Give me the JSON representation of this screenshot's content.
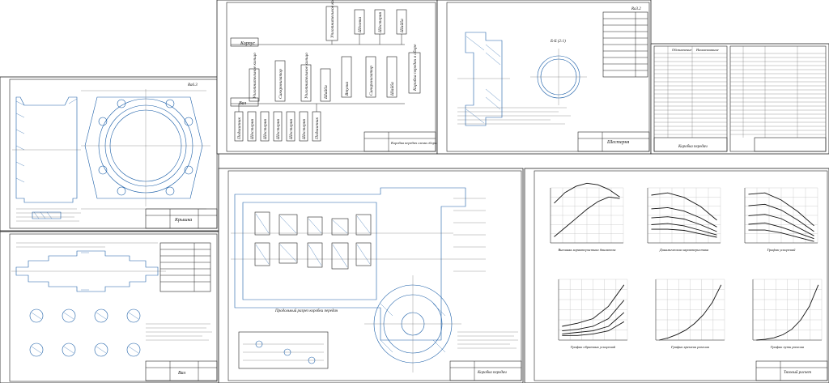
{
  "sheets": {
    "cover": {
      "title": "Крышка",
      "roughness": "Ra6.3"
    },
    "shaft": {
      "title": "Вал"
    },
    "assembly_scheme": {
      "title": "Коробка передач схема сборки",
      "nodes": {
        "base": "Корпус",
        "shaft": "Вал",
        "housing_top": "Подшипник",
        "seal": "Уплотнительное кольцо",
        "synchro": "Синхронизатор",
        "gear": "Шестерня",
        "bush": "Втулка",
        "washer": "Шайба",
        "key": "Шпонка",
        "nut": "Гайка",
        "gearbox": "Коробка передач в сборе"
      }
    },
    "gear": {
      "title": "Шестерня",
      "section": "Б-Б (2:1)",
      "roughness": "Ra3.2"
    },
    "spec": {
      "title": "Коробка передач",
      "col1": "Обозначение",
      "col2": "Наименование"
    },
    "assembly": {
      "title": "Коробка передач",
      "caption": "Продольный разрез коробки передач"
    },
    "charts": {
      "title": "Тяговый расчет",
      "captions": [
        "Внешняя характеристика двигателя",
        "Динамическая характеристика",
        "График ускорений",
        "График обратных ускорений",
        "График времени разгона",
        "График пути разгона"
      ]
    }
  },
  "chart_data": [
    {
      "type": "line",
      "title": "Внешняя характеристика двигателя",
      "xlabel": "n, об/мин",
      "ylabel_left": "Ne, кВт",
      "ylabel_right": "Me, Н·м",
      "x": [
        1000,
        2000,
        3000,
        4000,
        5000,
        6000,
        7000
      ],
      "series": [
        {
          "name": "Ne",
          "values": [
            20,
            50,
            80,
            110,
            135,
            150,
            145
          ]
        },
        {
          "name": "Me",
          "values": [
            130,
            165,
            185,
            195,
            190,
            175,
            150
          ]
        }
      ],
      "ylim": [
        0,
        180
      ]
    },
    {
      "type": "line",
      "title": "Динамическая характеристика",
      "xlabel": "V, м/с",
      "ylabel": "D",
      "series": [
        {
          "name": "1",
          "values": [
            0.42,
            0.44,
            0.4,
            0.32,
            0.2
          ]
        },
        {
          "name": "2",
          "values": [
            0.3,
            0.31,
            0.28,
            0.22,
            0.14
          ]
        },
        {
          "name": "3",
          "values": [
            0.22,
            0.23,
            0.21,
            0.16,
            0.1
          ]
        },
        {
          "name": "4",
          "values": [
            0.16,
            0.17,
            0.15,
            0.11,
            0.07
          ]
        },
        {
          "name": "5",
          "values": [
            0.12,
            0.12,
            0.11,
            0.08,
            0.05
          ]
        }
      ]
    },
    {
      "type": "line",
      "title": "График ускорений",
      "xlabel": "V, м/с",
      "ylabel": "j, м/с²",
      "series": [
        {
          "name": "1",
          "values": [
            3.4,
            3.5,
            3.0,
            2.2,
            1.2
          ]
        },
        {
          "name": "2",
          "values": [
            2.6,
            2.7,
            2.3,
            1.6,
            0.8
          ]
        },
        {
          "name": "3",
          "values": [
            1.9,
            2.0,
            1.7,
            1.1,
            0.5
          ]
        },
        {
          "name": "4",
          "values": [
            1.3,
            1.4,
            1.1,
            0.7,
            0.3
          ]
        },
        {
          "name": "5",
          "values": [
            0.9,
            0.9,
            0.7,
            0.4,
            0.1
          ]
        }
      ]
    },
    {
      "type": "line",
      "title": "График обратных ускорений",
      "xlabel": "V, м/с",
      "ylabel": "1/j",
      "series": [
        {
          "name": "1",
          "values": [
            0.3,
            0.3,
            0.4,
            0.6,
            1.2
          ]
        },
        {
          "name": "2",
          "values": [
            0.4,
            0.5,
            0.6,
            0.9,
            1.8
          ]
        },
        {
          "name": "3",
          "values": [
            0.6,
            0.7,
            0.9,
            1.4,
            2.6
          ]
        },
        {
          "name": "4",
          "values": [
            0.9,
            1.1,
            1.4,
            2.2,
            3.6
          ]
        }
      ]
    },
    {
      "type": "line",
      "title": "График времени разгона",
      "xlabel": "V, м/с",
      "ylabel": "t, с",
      "x": [
        0,
        5,
        10,
        15,
        20,
        25,
        30,
        35
      ],
      "values": [
        0,
        1,
        2.5,
        4.5,
        7.5,
        11.5,
        17,
        25
      ]
    },
    {
      "type": "line",
      "title": "График пути разгона",
      "xlabel": "V, м/с",
      "ylabel": "S, м",
      "x": [
        0,
        5,
        10,
        15,
        20,
        25,
        30,
        35
      ],
      "values": [
        0,
        5,
        15,
        35,
        70,
        130,
        220,
        360
      ]
    }
  ]
}
